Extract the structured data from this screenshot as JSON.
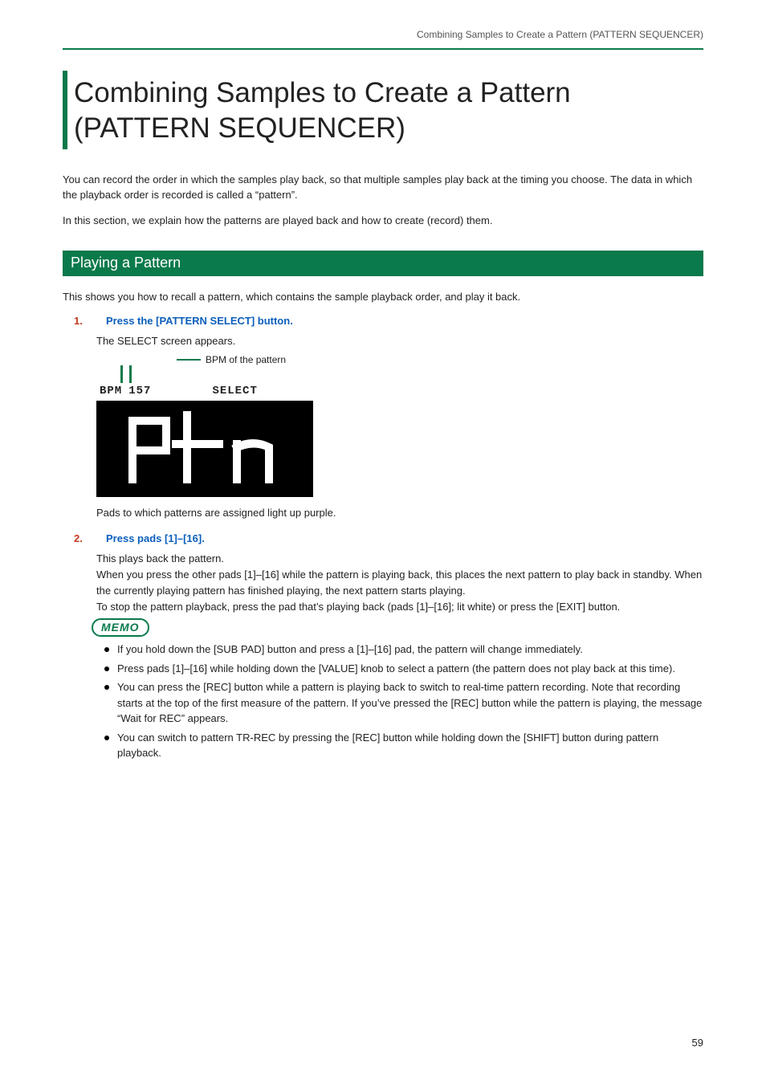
{
  "running_head": "Combining Samples to Create a Pattern (PATTERN SEQUENCER)",
  "title_line1": "Combining Samples to Create a Pattern",
  "title_line2": "(PATTERN SEQUENCER)",
  "intro1": "You can record the order in which the samples play back, so that multiple samples play back at the timing you choose. The data in which the playback order is recorded is called a “pattern”.",
  "intro2": "In this section, we explain how the patterns are played back and how to create (record) them.",
  "section_title": "Playing a Pattern",
  "section_intro": "This shows you how to recall a pattern, which contains the sample playback order, and play it back.",
  "step1": {
    "head": "Press the [PATTERN SELECT] button.",
    "line1": "The SELECT screen appears.",
    "callout": "BPM of the pattern",
    "lcd_bpm_label": "BPM",
    "lcd_bpm_value": "157",
    "lcd_select_label": "SELECT",
    "after_fig": "Pads to which patterns are assigned light up purple."
  },
  "step2": {
    "head": "Press pads [1]–[16].",
    "p1": "This plays back the pattern.",
    "p2": "When you press the other pads [1]–[16] while the pattern is playing back, this places the next pattern to play back in standby. When the currently playing pattern has finished playing, the next pattern starts playing.",
    "p3": "To stop the pattern playback, press the pad that’s playing back (pads [1]–[16]; lit white) or press the [EXIT] button."
  },
  "memo_label": "MEMO",
  "memo": [
    "If you hold down the [SUB PAD] button and press a [1]–[16] pad, the pattern will change immediately.",
    "Press pads [1]–[16] while holding down the [VALUE] knob to select a pattern (the pattern does not play back at this time).",
    "You can press the [REC] button while a pattern is playing back to switch to real-time pattern recording. Note that recording starts at the top of the first measure of the pattern. If you’ve pressed the [REC] button while the pattern is playing, the message “Wait for REC” appears.",
    "You can switch to pattern TR-REC by pressing the [REC] button while holding down the [SHIFT] button during pattern playback."
  ],
  "page_number": "59"
}
